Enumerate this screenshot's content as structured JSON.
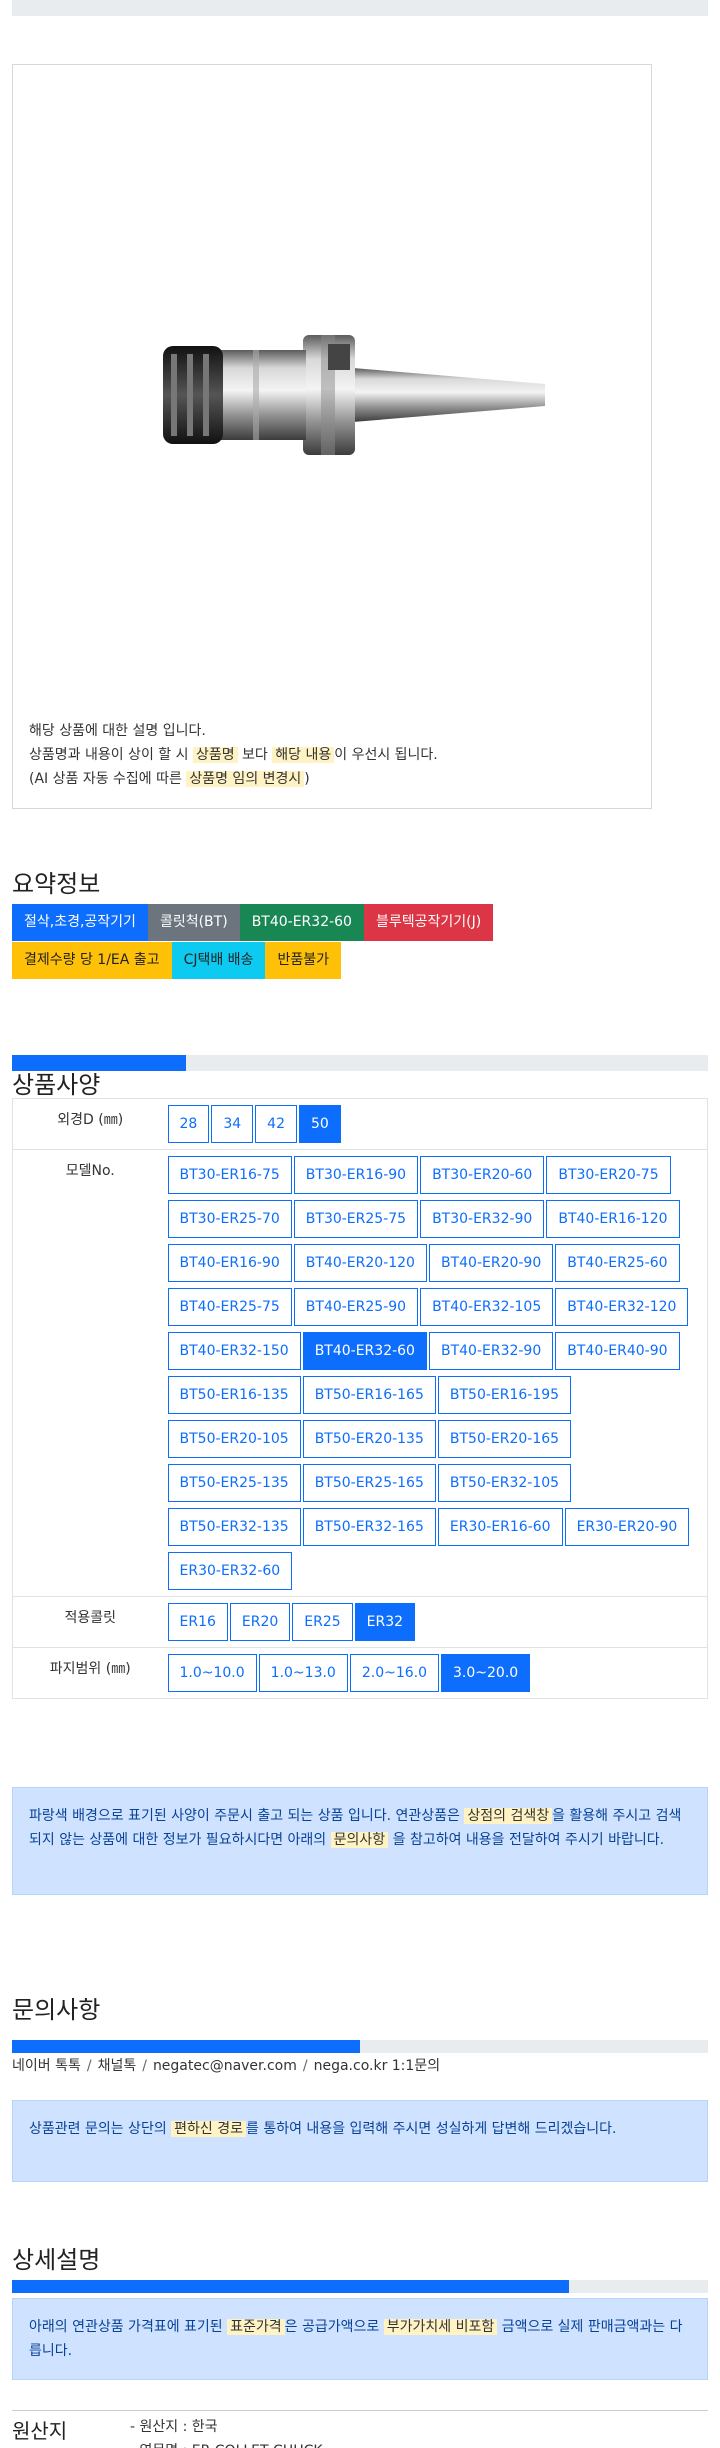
{
  "image_note": {
    "line1": "해당 상품에 대한 설명 입니다.",
    "line2_a": "상품명과 내용이 상이 할 시",
    "line2_hl1": "상품명",
    "line2_b": "보다",
    "line2_hl2": "해당 내용",
    "line2_c": "이 우선시 됩니다.",
    "line3_a": "(AI 상품 자동 수집에 따른",
    "line3_hl": "상품명 임의 변경시",
    "line3_b": ")"
  },
  "summary": {
    "title": "요약정보",
    "badges_row1": [
      {
        "label": "절삭,초경,공작기기",
        "color": "#0d6efd"
      },
      {
        "label": "콜릿척(BT)",
        "color": "#6c757d"
      },
      {
        "label": "BT40-ER32-60",
        "color": "#198754"
      },
      {
        "label": "블루텍공작기기(J)",
        "color": "#dc3545"
      }
    ],
    "badges_row2": [
      {
        "label": "결제수량 당 1/EA 출고",
        "color": "#ffc107"
      },
      {
        "label": "CJ택배 배송",
        "color": "#0dcaf0"
      },
      {
        "label": "반품불가",
        "color": "#ffc107"
      }
    ]
  },
  "spec": {
    "progress": 0.25,
    "title": "상품사양",
    "rows": [
      {
        "label": "외경D (㎜)",
        "options": [
          "28",
          "34",
          "42",
          "50"
        ],
        "selected": "50"
      },
      {
        "label": "모델No.",
        "options": [
          "BT30-ER16-75",
          "BT30-ER16-90",
          "BT30-ER20-60",
          "BT30-ER20-75",
          "BT30-ER25-70",
          "BT30-ER25-75",
          "BT30-ER32-90",
          "BT40-ER16-120",
          "BT40-ER16-90",
          "BT40-ER20-120",
          "BT40-ER20-90",
          "BT40-ER25-60",
          "BT40-ER25-75",
          "BT40-ER25-90",
          "BT40-ER32-105",
          "BT40-ER32-120",
          "BT40-ER32-150",
          "BT40-ER32-60",
          "BT40-ER32-90",
          "BT40-ER40-90",
          "BT50-ER16-135",
          "BT50-ER16-165",
          "BT50-ER16-195",
          "BT50-ER20-105",
          "BT50-ER20-135",
          "BT50-ER20-165",
          "BT50-ER25-135",
          "BT50-ER25-165",
          "BT50-ER32-105",
          "BT50-ER32-135",
          "BT50-ER32-165",
          "ER30-ER16-60",
          "ER30-ER20-90",
          "ER30-ER32-60"
        ],
        "selected": "BT40-ER32-60"
      },
      {
        "label": "적용콜릿",
        "options": [
          "ER16",
          "ER20",
          "ER25",
          "ER32"
        ],
        "selected": "ER32"
      },
      {
        "label": "파지범위 (㎜)",
        "options": [
          "1.0~10.0",
          "1.0~13.0",
          "2.0~16.0",
          "3.0~20.0"
        ],
        "selected": "3.0~20.0"
      }
    ],
    "notice_a": "파랑색 배경으로 표기된 사양이 주문시 출고 되는 상품 입니다. 연관상품은",
    "notice_hl1": "상점의 검색창",
    "notice_b": "을 활용해 주시고 검색되지 않는 상품에 대한 정보가 필요하시다면 아래의",
    "notice_hl2": "문의사항",
    "notice_c": "을 참고하여 내용을 전달하여 주시기 바랍니다."
  },
  "inquiry": {
    "title": "문의사항",
    "progress": 0.5,
    "links": [
      "네이버 톡톡",
      "채널톡",
      "negatec@naver.com",
      "nega.co.kr 1:1문의"
    ],
    "separator": "/",
    "notice_a": "상품관련 문의는 상단의",
    "notice_hl": "편하신 경로",
    "notice_b": "를 통하여 내용을 입력해 주시면 성실하게 답변해 드리겠습니다."
  },
  "detail": {
    "title": "상세설명",
    "progress": 0.8,
    "notice_a": "아래의 연관상품 가격표에 표기된",
    "notice_hl1": "표준가격",
    "notice_b": "은 공급가액으로",
    "notice_hl2": "부가가치세 비포함",
    "notice_c": "금액으로 실제 판매금액과는 다릅니다."
  },
  "origin": {
    "label": "원산지",
    "items": [
      "- 원산지 : 한국",
      "- 영문명 : ER COLLET CHUCK"
    ]
  }
}
